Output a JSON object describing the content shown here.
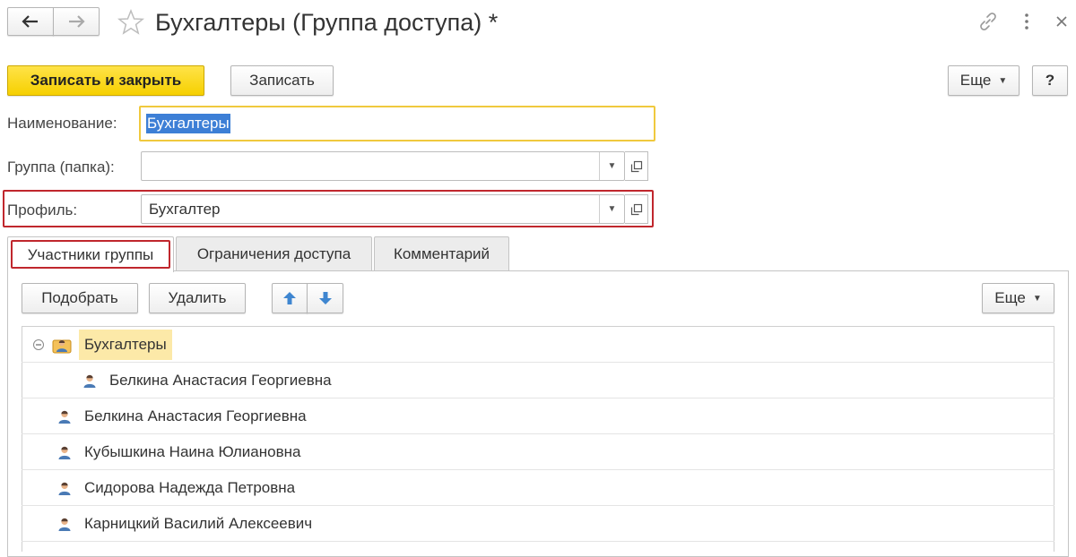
{
  "window": {
    "title": "Бухгалтеры (Группа доступа) *",
    "nav": {
      "back_icon": "arrow-left-icon",
      "forward_icon": "arrow-right-icon"
    },
    "favorite_icon": "star-icon",
    "link_icon": "link-icon",
    "menu_icon": "kebab-menu-icon",
    "close_icon": "close-icon"
  },
  "toolbar": {
    "save_close_label": "Записать и закрыть",
    "save_label": "Записать",
    "more_label": "Еще",
    "help_label": "?"
  },
  "form": {
    "name_label": "Наименование:",
    "name_value": "Бухгалтеры",
    "group_label": "Группа (папка):",
    "group_value": "",
    "profile_label": "Профиль:",
    "profile_value": "Бухгалтер"
  },
  "tabs": [
    {
      "label": "Участники группы",
      "active": true
    },
    {
      "label": "Ограничения доступа",
      "active": false
    },
    {
      "label": "Комментарий",
      "active": false
    }
  ],
  "members_toolbar": {
    "pick_label": "Подобрать",
    "delete_label": "Удалить",
    "move_up_icon": "arrow-up-icon",
    "move_down_icon": "arrow-down-icon",
    "more_label": "Еще"
  },
  "members": [
    {
      "name": "Бухгалтеры",
      "type": "group",
      "expanded": true,
      "level": 0
    },
    {
      "name": "Белкина Анастасия Георгиевна",
      "type": "user",
      "level": 1
    },
    {
      "name": "Белкина Анастасия Георгиевна",
      "type": "user",
      "level": 0
    },
    {
      "name": "Кубышкина Наина Юлиановна",
      "type": "user",
      "level": 0
    },
    {
      "name": "Сидорова Надежда Петровна",
      "type": "user",
      "level": 0
    },
    {
      "name": "Карницкий Василий Алексеевич",
      "type": "user",
      "level": 0
    }
  ],
  "colors": {
    "primary_button": "#f6d000",
    "highlight_border": "#c0272d",
    "focus_border": "#f0c93e",
    "selection": "#3d7fd6",
    "group_highlight": "#fce9a8",
    "nav_arrow_blue": "#3f86d0"
  }
}
